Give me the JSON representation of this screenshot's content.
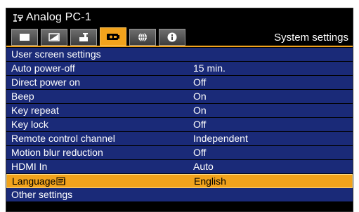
{
  "window": {
    "input_icon": "input-source-icon",
    "title": "Analog PC-1"
  },
  "tabs": [
    {
      "icon": "picture-icon",
      "active": false
    },
    {
      "icon": "image-adjust-icon",
      "active": false
    },
    {
      "icon": "install-settings-icon",
      "active": false
    },
    {
      "icon": "system-settings-icon",
      "active": true
    },
    {
      "icon": "network-globe-icon",
      "active": false
    },
    {
      "icon": "info-icon",
      "active": false
    }
  ],
  "section_title": "System settings",
  "menu": {
    "user_screen_settings": "User screen settings",
    "items": [
      {
        "label": "Auto power-off",
        "value": "15 min."
      },
      {
        "label": "Direct power on",
        "value": "Off"
      },
      {
        "label": "Beep",
        "value": "On"
      },
      {
        "label": "Key repeat",
        "value": "On"
      },
      {
        "label": "Key lock",
        "value": "Off"
      },
      {
        "label": "Remote control channel",
        "value": "Independent"
      },
      {
        "label": "Motion blur reduction",
        "value": "Off"
      },
      {
        "label": "HDMI In",
        "value": "Auto"
      },
      {
        "label": "Language",
        "value": "English",
        "help_icon": "help-book-icon",
        "selected": true
      }
    ],
    "other_settings": "Other settings"
  },
  "colors": {
    "background": "#000000",
    "row": "#1a2a78",
    "accent": "#f2a31c",
    "text": "#ffffff"
  }
}
